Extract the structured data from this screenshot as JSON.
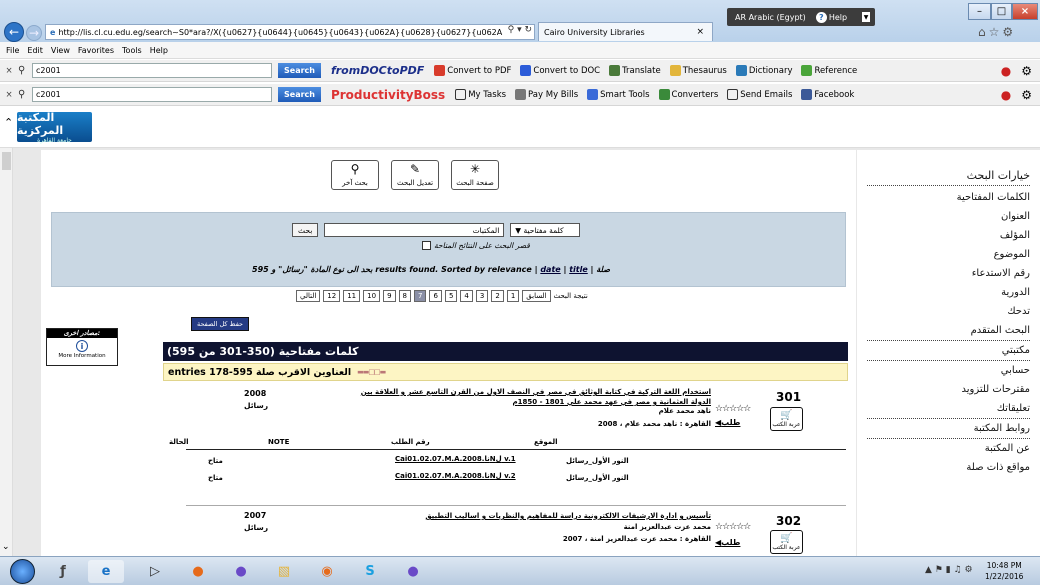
{
  "browser": {
    "url": "http://lis.cl.cu.edu.eg/search~S0*ara?/X({u0627}{u0644}{u0645}{u0643}{u062A}{u0628}{u0627}{u062A",
    "tab_title": "Cairo University Libraries",
    "lang_bar": "AR Arabic (Egypt)",
    "lang_help": "Help",
    "menu": [
      "File",
      "Edit",
      "View",
      "Favorites",
      "Tools",
      "Help"
    ]
  },
  "toolbar1": {
    "query": "c2001",
    "search_label": "Search",
    "brand": "fromDOCtoPDF",
    "items": [
      "Convert to PDF",
      "Convert to DOC",
      "Translate",
      "Thesaurus",
      "Dictionary",
      "Reference"
    ]
  },
  "toolbar2": {
    "query": "c2001",
    "search_label": "Search",
    "brand": "ProductivityBoss",
    "items": [
      "My Tasks",
      "Pay My Bills",
      "Smart Tools",
      "Converters",
      "Send Emails",
      "Facebook"
    ]
  },
  "logo": {
    "title": "المكتبة المركزية",
    "subtitle": "جامعة القاهرة"
  },
  "right_panel": {
    "heading": "خيارات البحث",
    "items": [
      "الكلمات المفتاحية",
      "العنوان",
      "المؤلف",
      "الموضوع",
      "رقم الاستدعاء",
      "الدورية",
      "تدحك",
      "البحث المتقدم",
      "مكتبتي",
      "حسابي",
      "مقترحات للتزويد",
      "تعليقاتك",
      "روابط المكتبة",
      "عن المكتبة",
      "مواقع ذات صلة"
    ]
  },
  "top_buttons": [
    "صفحة البحث",
    "تعديل البحث",
    "بحث آخر"
  ],
  "search_panel": {
    "search_type": "كلمة مفتاحية",
    "query": "المكتبات",
    "submit": "بحث",
    "limit_label": "قصر البحث على النتائج المتاحة",
    "results_prefix": "بحد الى نوع المادة \"رسائل\" و",
    "results_count": "595",
    "results_suffix": "results found. Sorted by relevance |",
    "sort_date": "date",
    "sort_title": "title",
    "sort_tail": "صلة"
  },
  "pager": {
    "label": "نتيجة البحث",
    "prev": "السابق",
    "pages": [
      "1",
      "2",
      "3",
      "4",
      "5",
      "6",
      "7",
      "8",
      "9",
      "10",
      "11",
      "12"
    ],
    "current": "7",
    "next": "التالي"
  },
  "save_all": "حفظ كل الصفحة",
  "left_box": {
    "heading": "مصادر اخرى:",
    "label": "More Information"
  },
  "results_header": "كلمات مفتاحية (350-301 من 595)",
  "relevance_bar": "entries 178-595 العناوين الاقرب صلة",
  "records": [
    {
      "num": "301",
      "year": "2008",
      "type": "رسائل",
      "title1": "استخدام اللغة التركية في كتابة الوثائق في مصر في النصف الاول من القرن التاسع عشر و العلاقة بين",
      "title2": "الدولة العثمانية و مصر في عهد محمد علي 1801 - 1850م",
      "author": "ناهد محمد علام",
      "pub": "القاهرة : ناهد محمد علام ، 2008",
      "request": "طلب",
      "cart": "عربة الكتب",
      "table_headers": [
        "الحالة",
        "NOTE",
        "رقم الطلب",
        "الموقع"
      ],
      "rows": [
        {
          "status": "متاح",
          "call": "Cai01.02.07.M.A.2008.ناNل v.1",
          "loc": "النور الأول_رسائل"
        },
        {
          "status": "متاح",
          "call": "Cai01.02.07.M.A.2008.ناNل v.2",
          "loc": "النور الأول_رسائل"
        }
      ]
    },
    {
      "num": "302",
      "year": "2007",
      "type": "رسائل",
      "title1": "تأسيس و ادارة الارشيفات الالكترونية دراسة للمفاهيم والنظريات و اساليب التطبيق",
      "author": "محمد عزت عبدالعزيز امنة",
      "pub": "القاهرة : محمد عزت عبدالعزيز امنة ، 2007",
      "request": "طلب",
      "cart": "عربة الكتب"
    }
  ],
  "clock": {
    "time": "10:48 PM",
    "date": "1/22/2016"
  },
  "colors": {
    "header_bar": "#0e1330",
    "search_panel": "#c9d7e3",
    "relevance_bar": "#fdf5c4"
  }
}
